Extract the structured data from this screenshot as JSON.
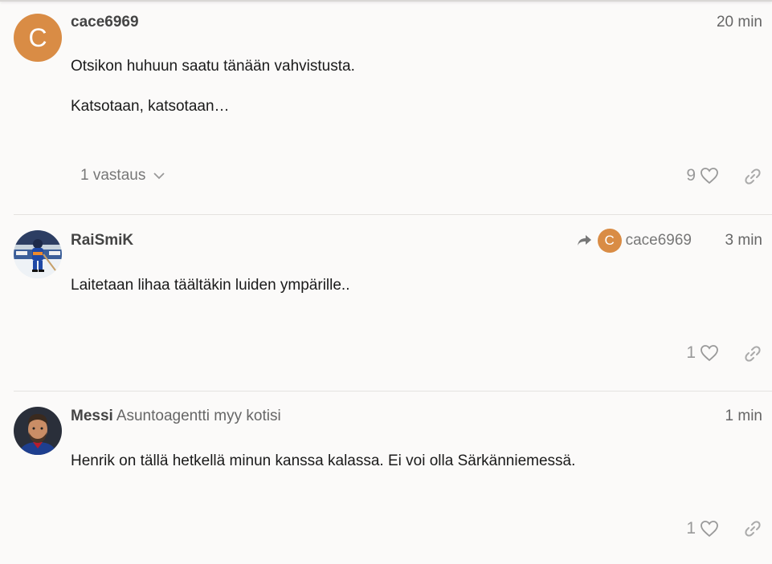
{
  "posts": [
    {
      "username": "cace6969",
      "avatar_letter": "C",
      "time": "20 min",
      "paragraphs": [
        "Otsikon huhuun saatu tänään vahvistusta.",
        "Katsotaan, katsotaan…"
      ],
      "replies_label": "1 vastaus",
      "likes": "9"
    },
    {
      "username": "RaiSmiK",
      "reply_to_letter": "C",
      "reply_to_user": "cace6969",
      "time": "3 min",
      "paragraphs": [
        "Laitetaan lihaa täältäkin luiden ympärille.."
      ],
      "likes": "1"
    },
    {
      "username": "Messi",
      "user_title": "Asuntoagentti myy kotisi",
      "time": "1 min",
      "paragraphs": [
        "Henrik on tällä hetkellä minun kanssa kalassa. Ei voi olla Särkänniemessä."
      ],
      "likes": "1"
    }
  ],
  "colors": {
    "background": "#fbfaf9",
    "avatar_orange": "#d98c45",
    "muted_text": "#777777",
    "divider": "#e4e2e0"
  },
  "icons": [
    "chevron-down-icon",
    "heart-icon",
    "link-icon",
    "reply-arrow-icon"
  ]
}
